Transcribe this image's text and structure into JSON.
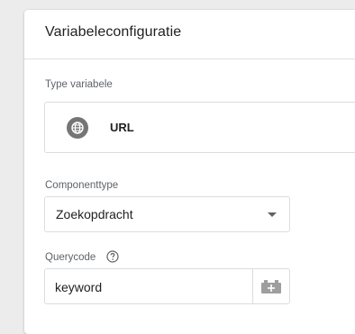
{
  "card": {
    "title": "Variabeleconfiguratie"
  },
  "variable_type": {
    "label": "Type variabele",
    "name": "URL",
    "icon": "globe-icon"
  },
  "component_type": {
    "label": "Componenttype",
    "selected": "Zoekopdracht"
  },
  "query_key": {
    "label": "Querycode",
    "value": "keyword",
    "help_icon": "help-circle-icon",
    "picker_icon": "variable-picker-icon"
  },
  "colors": {
    "icon_gray": "#757575",
    "border": "#dadce0",
    "text": "#212121",
    "label": "#5f6368"
  }
}
